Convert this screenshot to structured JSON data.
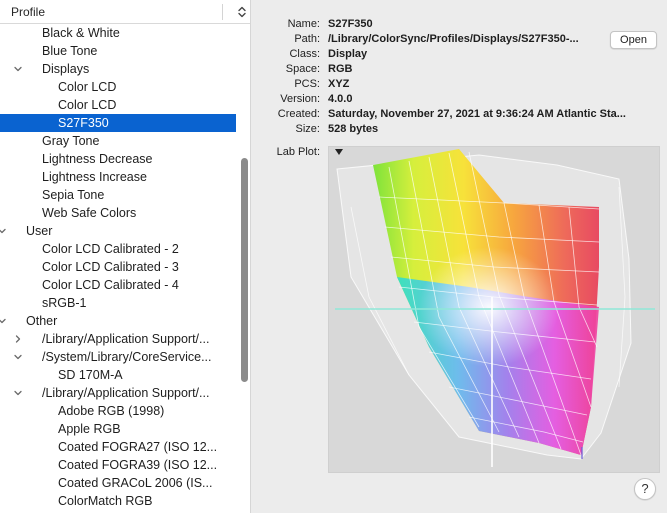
{
  "sidebar": {
    "header": "Profile",
    "rows": [
      {
        "label": "Black & White",
        "indent": 1,
        "disclosure": "none",
        "selected": false
      },
      {
        "label": "Blue Tone",
        "indent": 1,
        "disclosure": "none",
        "selected": false
      },
      {
        "label": "Displays",
        "indent": 1,
        "disclosure": "open",
        "selected": false
      },
      {
        "label": "Color LCD",
        "indent": 2,
        "disclosure": "none",
        "selected": false
      },
      {
        "label": "Color LCD",
        "indent": 2,
        "disclosure": "none",
        "selected": false
      },
      {
        "label": "S27F350",
        "indent": 2,
        "disclosure": "none",
        "selected": true
      },
      {
        "label": "Gray Tone",
        "indent": 1,
        "disclosure": "none",
        "selected": false
      },
      {
        "label": "Lightness Decrease",
        "indent": 1,
        "disclosure": "none",
        "selected": false
      },
      {
        "label": "Lightness Increase",
        "indent": 1,
        "disclosure": "none",
        "selected": false
      },
      {
        "label": "Sepia Tone",
        "indent": 1,
        "disclosure": "none",
        "selected": false
      },
      {
        "label": "Web Safe Colors",
        "indent": 1,
        "disclosure": "none",
        "selected": false
      },
      {
        "label": "User",
        "indent": 0,
        "disclosure": "open",
        "selected": false
      },
      {
        "label": "Color LCD Calibrated - 2",
        "indent": 1,
        "disclosure": "none",
        "selected": false
      },
      {
        "label": "Color LCD Calibrated - 3",
        "indent": 1,
        "disclosure": "none",
        "selected": false
      },
      {
        "label": "Color LCD Calibrated - 4",
        "indent": 1,
        "disclosure": "none",
        "selected": false
      },
      {
        "label": "sRGB-1",
        "indent": 1,
        "disclosure": "none",
        "selected": false
      },
      {
        "label": "Other",
        "indent": 0,
        "disclosure": "open",
        "selected": false
      },
      {
        "label": "/Library/Application Support/...",
        "indent": 1,
        "disclosure": "closed",
        "selected": false
      },
      {
        "label": "/System/Library/CoreService...",
        "indent": 1,
        "disclosure": "open",
        "selected": false
      },
      {
        "label": "SD 170M-A",
        "indent": 2,
        "disclosure": "none",
        "selected": false
      },
      {
        "label": "/Library/Application Support/...",
        "indent": 1,
        "disclosure": "open",
        "selected": false
      },
      {
        "label": "Adobe RGB (1998)",
        "indent": 2,
        "disclosure": "none",
        "selected": false
      },
      {
        "label": "Apple RGB",
        "indent": 2,
        "disclosure": "none",
        "selected": false
      },
      {
        "label": "Coated FOGRA27 (ISO 12...",
        "indent": 2,
        "disclosure": "none",
        "selected": false
      },
      {
        "label": "Coated FOGRA39 (ISO 12...",
        "indent": 2,
        "disclosure": "none",
        "selected": false
      },
      {
        "label": "Coated GRACoL 2006 (IS...",
        "indent": 2,
        "disclosure": "none",
        "selected": false
      },
      {
        "label": "ColorMatch RGB",
        "indent": 2,
        "disclosure": "none",
        "selected": false
      }
    ]
  },
  "info": {
    "fields": [
      {
        "key": "Name:",
        "value": "S27F350"
      },
      {
        "key": "Path:",
        "value": "/Library/ColorSync/Profiles/Displays/S27F350-..."
      },
      {
        "key": "Class:",
        "value": "Display"
      },
      {
        "key": "Space:",
        "value": "RGB"
      },
      {
        "key": "PCS:",
        "value": "XYZ"
      },
      {
        "key": "Version:",
        "value": "4.0.0"
      },
      {
        "key": "Created:",
        "value": "Saturday, November 27, 2021 at 9:36:24 AM Atlantic Sta..."
      },
      {
        "key": "Size:",
        "value": "528 bytes"
      }
    ],
    "open_label": "Open",
    "plot_label": "Lab Plot:",
    "help_label": "?"
  },
  "icons": {
    "sort": "chevron-up-down-icon",
    "disclosure_open": "chevron-down-icon",
    "disclosure_closed": "chevron-right-icon",
    "plot_menu": "triangle-down-icon"
  },
  "colors": {
    "selection": "#0a63d0",
    "plot_background": "#d8d8d8",
    "window_background": "#ececec"
  }
}
